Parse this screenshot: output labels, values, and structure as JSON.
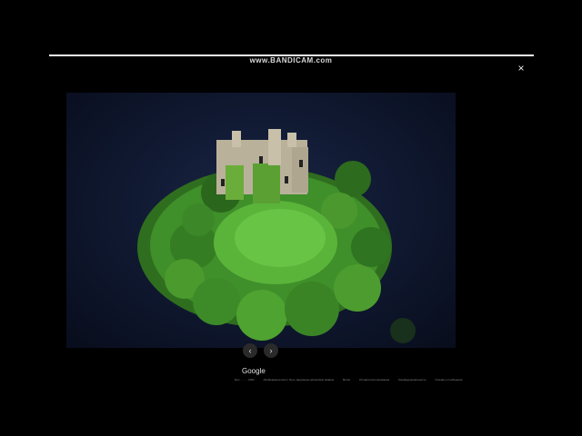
{
  "watermark": "www.BANDICAM.com",
  "viewer": {
    "close_icon": "×",
    "image_icon": "castle-island-photo",
    "prev_icon": "‹",
    "next_icon": "›"
  },
  "footer": {
    "brand": "Google",
    "links": [
      "Dev... ... ... 2021",
      "Изображения могут быть защищены авторским правом",
      "Фотки",
      "Условия использования",
      "Конфиденциальность",
      "Отзывы и сообщения"
    ]
  },
  "colors": {
    "background": "#000000",
    "water": "#111a33",
    "foliage": "#3f8f2a",
    "ruins": "#b9b19a"
  }
}
